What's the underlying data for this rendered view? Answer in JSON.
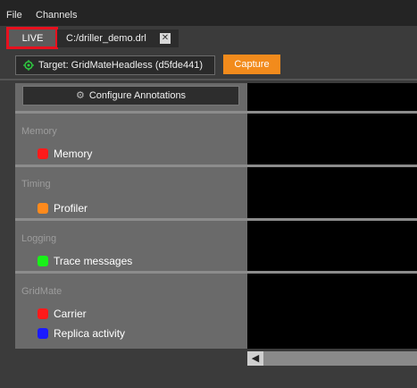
{
  "menu": {
    "file": "File",
    "channels": "Channels"
  },
  "tabs": {
    "live": "LIVE",
    "file": "C:/driller_demo.drl",
    "close": "✕"
  },
  "toolbar": {
    "target_label": "Target: GridMateHeadless (d5fde441)",
    "capture": "Capture"
  },
  "annotations": {
    "configure": "Configure Annotations"
  },
  "sections": [
    {
      "title": "Memory",
      "channels": [
        {
          "label": "Memory",
          "color": "#ff1a1a"
        }
      ]
    },
    {
      "title": "Timing",
      "channels": [
        {
          "label": "Profiler",
          "color": "#ff8a1c"
        }
      ]
    },
    {
      "title": "Logging",
      "channels": [
        {
          "label": "Trace messages",
          "color": "#19f019"
        }
      ]
    },
    {
      "title": "GridMate",
      "channels": [
        {
          "label": "Carrier",
          "color": "#ff1a1a"
        },
        {
          "label": "Replica activity",
          "color": "#1a1aff"
        }
      ]
    }
  ],
  "colors": {
    "accent_capture": "#f28b1c",
    "highlight": "#e8101e",
    "target_icon": "#2ecc40"
  },
  "icons": {
    "target": "target-icon",
    "gear": "gear-icon",
    "close": "close-icon",
    "scroll_left": "arrow-left-icon"
  }
}
